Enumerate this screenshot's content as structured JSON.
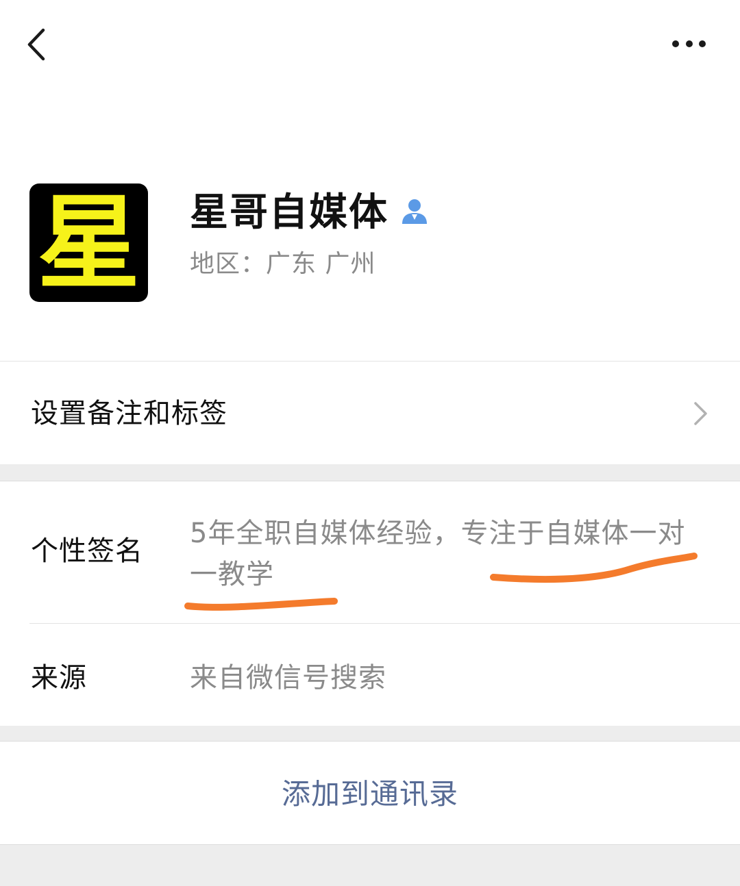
{
  "profile": {
    "name": "星哥自媒体",
    "region": "地区：广东  广州",
    "avatar_text": "星",
    "verified_icon": "person-icon"
  },
  "nav": {
    "back_icon": "chevron-left-icon",
    "more_icon": "more-dots-icon"
  },
  "remark_row": {
    "label": "设置备注和标签",
    "chevron_icon": "chevron-right-icon"
  },
  "info": {
    "signature_label": "个性签名",
    "signature_value": "5年全职自媒体经验，专注于自媒体一对一教学",
    "source_label": "来源",
    "source_value": "来自微信号搜索"
  },
  "action": {
    "add_contact_label": "添加到通讯录"
  },
  "colors": {
    "link_blue": "#576b95",
    "annotation_orange": "#f47b2c",
    "avatar_yellow": "#f6f21a",
    "verified_blue": "#5b9ae6"
  }
}
